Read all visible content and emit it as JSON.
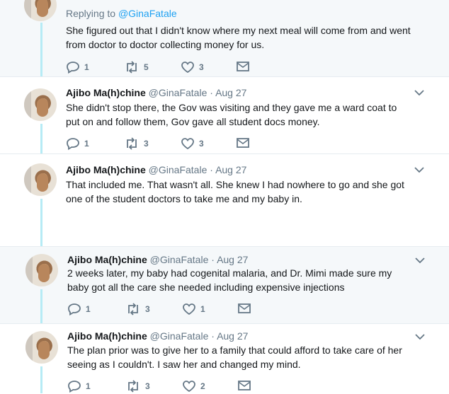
{
  "tweets": [
    {
      "replying_prefix": "Replying to ",
      "replying_handle": "@GinaFatale",
      "text_lines": [
        "She figured out that I didn't know where my next meal will come from and went",
        "from doctor to doctor collecting money for us."
      ],
      "reply_count": "1",
      "retweet_count": "5",
      "like_count": "3"
    },
    {
      "name": "Ajibo Ma(h)chine",
      "handle": "@GinaFatale",
      "dot": "·",
      "date": "Aug 27",
      "text_lines": [
        "She didn't stop there, the Gov was visiting and they gave me a ward coat to",
        "put on and follow them, Gov gave all student docs money."
      ],
      "reply_count": "1",
      "retweet_count": "3",
      "like_count": "3"
    },
    {
      "name": "Ajibo Ma(h)chine",
      "handle": "@GinaFatale",
      "dot": "·",
      "date": "Aug 27",
      "text_lines": [
        "That included me. That wasn't all. She knew I had nowhere to go and she got",
        "one of the student doctors to take me and my baby in."
      ]
    },
    {
      "name": "Ajibo Ma(h)chine",
      "handle": "@GinaFatale",
      "dot": "·",
      "date": "Aug 27",
      "text_lines": [
        "2 weeks later, my baby had cogenital malaria, and Dr. Mimi made sure my",
        "baby got all the care she needed including expensive injections"
      ],
      "reply_count": "1",
      "retweet_count": "3",
      "like_count": "1"
    },
    {
      "name": "Ajibo Ma(h)chine",
      "handle": "@GinaFatale",
      "dot": "·",
      "date": "Aug 27",
      "text_lines": [
        "The plan prior was to give her to a family that could afford to take care of her",
        "seeing as I couldn't. I saw her and changed my mind."
      ],
      "reply_count": "1",
      "retweet_count": "3",
      "like_count": "2"
    }
  ],
  "colors": {
    "highlight_bg": "#f5f8fa",
    "thread_line": "#b6ebf5",
    "link": "#1da1f2",
    "secondary_text": "#657786"
  }
}
